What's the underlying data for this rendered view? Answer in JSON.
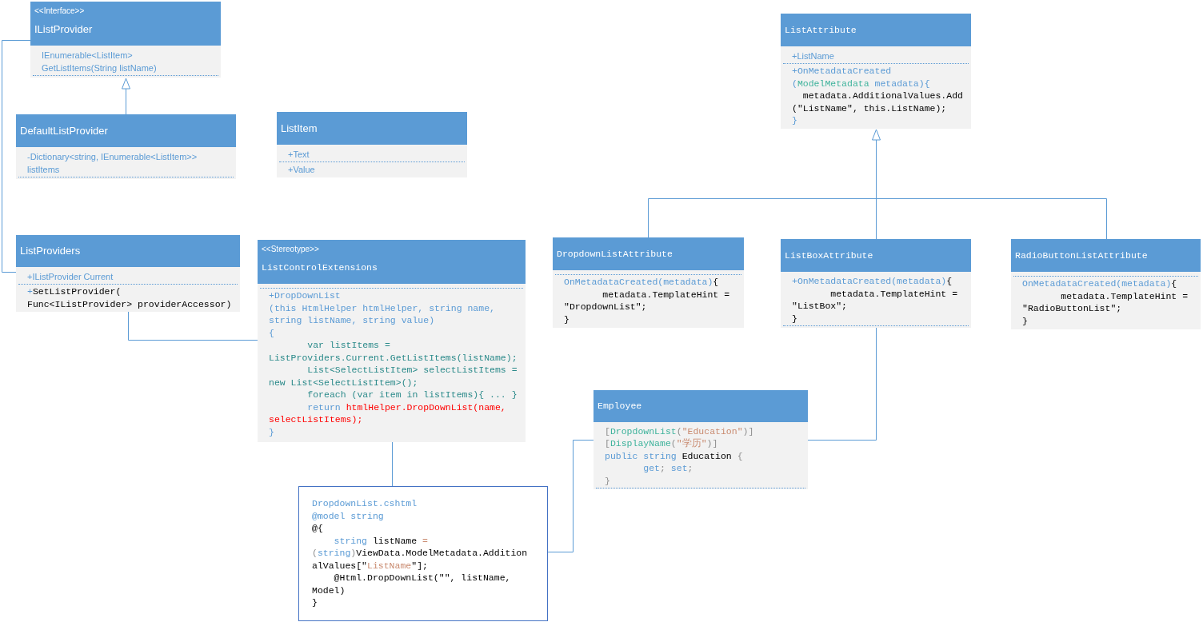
{
  "diagram": {
    "nodes": [
      {
        "kind": "class",
        "stereotype": "<<Interface>>",
        "name": "IListProvider",
        "attributes": [
          [
            {
              "text": "IEnumerable<ListItem>",
              "kind": "prose"
            }
          ],
          [
            {
              "text": "GetListItems(String listName)",
              "kind": "prose"
            }
          ]
        ]
      },
      {
        "kind": "code_class",
        "name": "ListAttribute",
        "attributes": [
          [
            {
              "text": "+ListName",
              "kind": "prose"
            }
          ]
        ],
        "operations": [
          [
            {
              "text": "+OnMetadataCreated",
              "kind": "keyword"
            }
          ],
          [
            {
              "text": "(",
              "kind": "keyword"
            },
            {
              "text": "ModelMetadata",
              "kind": "type"
            },
            {
              "text": " metadata){",
              "kind": "keyword"
            }
          ],
          [
            {
              "text": "  metadata.AdditionalValues.Add",
              "kind": "plain"
            }
          ],
          [
            {
              "text": "(\"ListName\", this.ListName);",
              "kind": "plain"
            }
          ],
          [
            {
              "text": "}",
              "kind": "keyword"
            }
          ]
        ]
      },
      {
        "kind": "class",
        "name": "DefaultListProvider",
        "attributes": [
          [
            {
              "text": "-Dictionary<string, IEnumerable<ListItem>>",
              "kind": "prose"
            }
          ],
          [
            {
              "text": "listItems",
              "kind": "prose"
            }
          ]
        ]
      },
      {
        "kind": "class",
        "name": "ListItem",
        "attributes": [
          [
            {
              "text": "+Text",
              "kind": "prose"
            }
          ]
        ],
        "operations": [
          [
            {
              "text": "+Value",
              "kind": "prose"
            }
          ]
        ]
      },
      {
        "kind": "class",
        "name": "ListProviders",
        "attributes": [
          [
            {
              "text": "+IListProvider Current",
              "kind": "prose"
            }
          ]
        ],
        "operations": [
          [
            {
              "text": "+",
              "kind": "keyword"
            },
            {
              "text": "SetListProvider(",
              "kind": "plain"
            }
          ],
          [
            {
              "text": "Func<IListProvider> providerAccessor)",
              "kind": "plain"
            }
          ]
        ]
      },
      {
        "kind": "code_class",
        "stereotype": "<<Stereotype>>",
        "name": "ListControlExtensions",
        "operations": [
          [
            {
              "text": "+DropDownList",
              "kind": "keyword"
            }
          ],
          [
            {
              "text": "(this HtmlHelper htmlHelper, string name,",
              "kind": "keyword"
            }
          ],
          [
            {
              "text": "string listName, string value)",
              "kind": "keyword"
            }
          ],
          [
            {
              "text": "{",
              "kind": "keyword"
            }
          ],
          [
            {
              "text": "       var listItems =",
              "kind": "statement"
            }
          ],
          [
            {
              "text": "ListProviders.Current.GetListItems(listName);",
              "kind": "statement"
            }
          ],
          [
            {
              "text": "       List<SelectListItem> selectListItems =",
              "kind": "statement"
            }
          ],
          [
            {
              "text": "new List<SelectListItem>();",
              "kind": "statement"
            }
          ],
          [
            {
              "text": "       foreach (var item in listItems){ ... }",
              "kind": "statement"
            }
          ],
          [
            {
              "text": "       return ",
              "kind": "keyword"
            },
            {
              "text": "htmlHelper.DropDownList(name,",
              "kind": "highlight"
            }
          ],
          [
            {
              "text": "selectListItems);",
              "kind": "highlight"
            }
          ],
          [
            {
              "text": "}",
              "kind": "keyword"
            }
          ]
        ]
      },
      {
        "kind": "code_class",
        "name": "DropdownListAttribute",
        "operations": [
          [
            {
              "text": "OnMetadataCreated(metadata)",
              "kind": "keyword"
            },
            {
              "text": "{",
              "kind": "plain"
            }
          ],
          [
            {
              "text": "       metadata.TemplateHint =",
              "kind": "plain"
            }
          ],
          [
            {
              "text": "\"DropdownList\";",
              "kind": "plain"
            }
          ],
          [
            {
              "text": "}",
              "kind": "plain"
            }
          ]
        ]
      },
      {
        "kind": "code_class",
        "name": "ListBoxAttribute",
        "attributes": [
          [
            {
              "text": "+OnMetadataCreated(metadata)",
              "kind": "keyword"
            },
            {
              "text": "{",
              "kind": "plain"
            }
          ],
          [
            {
              "text": "       metadata.TemplateHint =",
              "kind": "plain"
            }
          ],
          [
            {
              "text": "\"ListBox\";",
              "kind": "plain"
            }
          ],
          [
            {
              "text": "}",
              "kind": "plain"
            }
          ]
        ]
      },
      {
        "kind": "code_class",
        "name": "RadioButtonListAttribute",
        "operations": [
          [
            {
              "text": "OnMetadataCreated(metadata)",
              "kind": "keyword"
            },
            {
              "text": "{",
              "kind": "plain"
            }
          ],
          [
            {
              "text": "       metadata.TemplateHint =",
              "kind": "plain"
            }
          ],
          [
            {
              "text": "\"RadioButtonList\";",
              "kind": "plain"
            }
          ],
          [
            {
              "text": "}",
              "kind": "plain"
            }
          ]
        ]
      },
      {
        "kind": "code_class",
        "name": "Employee",
        "attributes": [
          [
            {
              "text": "[",
              "kind": "faint"
            },
            {
              "text": "DropdownList",
              "kind": "type"
            },
            {
              "text": "(",
              "kind": "faint"
            },
            {
              "text": "\"Education\"",
              "kind": "string"
            },
            {
              "text": ")]",
              "kind": "faint"
            }
          ],
          [
            {
              "text": "[",
              "kind": "faint"
            },
            {
              "text": "DisplayName",
              "kind": "type"
            },
            {
              "text": "(",
              "kind": "faint"
            },
            {
              "text": "\"学历\"",
              "kind": "string"
            },
            {
              "text": ")]",
              "kind": "faint"
            }
          ],
          [
            {
              "text": "public string ",
              "kind": "keyword"
            },
            {
              "text": "Education",
              "kind": "plain"
            },
            {
              "text": " {",
              "kind": "faint"
            }
          ],
          [
            {
              "text": "       get",
              "kind": "keyword"
            },
            {
              "text": "; ",
              "kind": "faint"
            },
            {
              "text": "set",
              "kind": "keyword"
            },
            {
              "text": ";",
              "kind": "faint"
            }
          ],
          [
            {
              "text": "}",
              "kind": "faint"
            }
          ]
        ]
      },
      {
        "kind": "file",
        "lines": [
          [
            {
              "text": "DropdownList.cshtml",
              "kind": "keyword"
            }
          ],
          [
            {
              "text": "@model string",
              "kind": "keyword"
            }
          ],
          [
            {
              "text": "@{",
              "kind": "plain"
            }
          ],
          [
            {
              "text": "    string ",
              "kind": "keyword"
            },
            {
              "text": "listName ",
              "kind": "plain"
            },
            {
              "text": "=",
              "kind": "string"
            }
          ],
          [
            {
              "text": "(",
              "kind": "faint"
            },
            {
              "text": "string",
              "kind": "keyword"
            },
            {
              "text": ")",
              "kind": "faint"
            },
            {
              "text": "ViewData.ModelMetadata.Addition",
              "kind": "plain"
            }
          ],
          [
            {
              "text": "alValues[\"",
              "kind": "plain"
            },
            {
              "text": "ListName",
              "kind": "string"
            },
            {
              "text": "\"];",
              "kind": "plain"
            }
          ],
          [
            {
              "text": "    @Html.DropDownList(\"\", listName,",
              "kind": "plain"
            }
          ],
          [
            {
              "text": "Model)",
              "kind": "plain"
            }
          ],
          [
            {
              "text": "}",
              "kind": "plain"
            }
          ]
        ]
      }
    ]
  }
}
